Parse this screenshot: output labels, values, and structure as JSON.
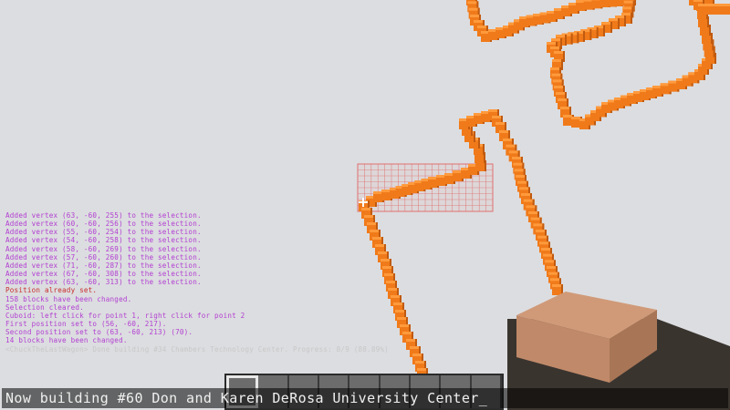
{
  "colors": {
    "sky": "#dcdde0",
    "block_front": "#f07a1a",
    "block_top": "#ff9a3c",
    "block_side": "#c05a10",
    "selection_grid": "#e07070",
    "chat_purple": "#b23fd2",
    "chat_red": "#c82c2c",
    "chat_gray": "#c8c8c8",
    "hand_skin": "#c08a6a",
    "hand_sleeve": "#3a342f"
  },
  "chat": {
    "lines": [
      {
        "text": "Added vertex (63, -60, 255) to the selection.",
        "color": "#b23fd2"
      },
      {
        "text": "Added vertex (60, -60, 256) to the selection.",
        "color": "#b23fd2"
      },
      {
        "text": "Added vertex (55, -60, 254) to the selection.",
        "color": "#b23fd2"
      },
      {
        "text": "Added vertex (54, -60, 258) to the selection.",
        "color": "#b23fd2"
      },
      {
        "text": "Added vertex (58, -60, 269) to the selection.",
        "color": "#b23fd2"
      },
      {
        "text": "Added vertex (57, -60, 260) to the selection.",
        "color": "#b23fd2"
      },
      {
        "text": "Added vertex (71, -60, 287) to the selection.",
        "color": "#b23fd2"
      },
      {
        "text": "Added vertex (67, -60, 308) to the selection.",
        "color": "#b23fd2"
      },
      {
        "text": "Added vertex (63, -60, 313) to the selection.",
        "color": "#b23fd2"
      },
      {
        "text": "Position already set.",
        "color": "#c82c2c"
      },
      {
        "text": "158 blocks have been changed.",
        "color": "#b23fd2"
      },
      {
        "text": "Selection cleared.",
        "color": "#b23fd2"
      },
      {
        "text": "Cuboid: left click for point 1, right click for point 2",
        "color": "#b23fd2"
      },
      {
        "text": "First position set to (56, -60, 217).",
        "color": "#b23fd2"
      },
      {
        "text": "Second position set to (63, -60, 213) (70).",
        "color": "#b23fd2"
      },
      {
        "text": "14 blocks have been changed.",
        "color": "#b23fd2"
      },
      {
        "text": "<ChuckTheLastWagon> Done building #34 Chambers Technology Center. Progress: 8/9 (88.89%)",
        "color": "#c8c8c8"
      }
    ]
  },
  "chat_input": {
    "value": "Now building #60 Don and Karen DeRosa University Center_"
  },
  "hotbar": {
    "selected_slot": 0
  }
}
